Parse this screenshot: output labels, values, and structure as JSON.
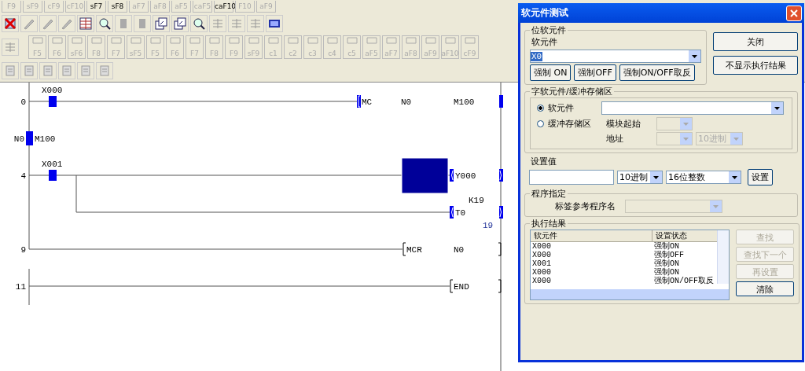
{
  "toolbar_keys_top": [
    {
      "key": "F9",
      "disabled": true
    },
    {
      "key": "sF9",
      "disabled": true
    },
    {
      "key": "cF9",
      "disabled": true
    },
    {
      "key": "cF10",
      "disabled": true
    },
    {
      "key": "sF7",
      "disabled": false
    },
    {
      "key": "sF8",
      "disabled": false
    },
    {
      "key": "aF7",
      "disabled": true
    },
    {
      "key": "aF8",
      "disabled": true
    },
    {
      "key": "aF5",
      "disabled": true
    },
    {
      "key": "caF5",
      "disabled": true
    },
    {
      "key": "caF10",
      "disabled": false
    },
    {
      "key": "F10",
      "disabled": true
    },
    {
      "key": "aF9",
      "disabled": true
    }
  ],
  "toolbar_keys": [
    {
      "key": "F5",
      "disabled": true
    },
    {
      "key": "F6",
      "disabled": true
    },
    {
      "key": "sF6",
      "disabled": true
    },
    {
      "key": "F8",
      "disabled": true
    },
    {
      "key": "F7",
      "disabled": true
    },
    {
      "key": "sF5",
      "disabled": true
    },
    {
      "key": "F5",
      "disabled": true
    },
    {
      "key": "F6",
      "disabled": true
    },
    {
      "key": "F7",
      "disabled": true
    },
    {
      "key": "F8",
      "disabled": true
    },
    {
      "key": "F9",
      "disabled": true
    },
    {
      "key": "sF9",
      "disabled": true
    },
    {
      "key": "c1",
      "disabled": true
    },
    {
      "key": "c2",
      "disabled": true
    },
    {
      "key": "c3",
      "disabled": true
    },
    {
      "key": "c4",
      "disabled": true
    },
    {
      "key": "c5",
      "disabled": true
    },
    {
      "key": "aF5",
      "disabled": true
    },
    {
      "key": "aF7",
      "disabled": true
    },
    {
      "key": "aF8",
      "disabled": true
    },
    {
      "key": "aF9",
      "disabled": true
    },
    {
      "key": "aF10",
      "disabled": true
    },
    {
      "key": "cF9",
      "disabled": true
    }
  ],
  "ladder": {
    "rungs": [
      {
        "kind": "mc",
        "step": "0",
        "contact": "X000",
        "instruction": "MC",
        "operands": [
          "N0",
          "M100"
        ],
        "selected": false
      },
      {
        "kind": "nest",
        "nest": "N0",
        "device": "M100",
        "selected": false
      },
      {
        "kind": "coils",
        "step": "4",
        "contact": "X001",
        "selected": true,
        "coils": [
          {
            "device": "Y000"
          },
          {
            "device": "T0",
            "setting": "K19",
            "current": "19"
          }
        ]
      },
      {
        "kind": "mcr",
        "step": "9",
        "instruction": "MCR",
        "operands": [
          "N0"
        ],
        "selected": false
      },
      {
        "kind": "end",
        "step": "11",
        "instruction": "END",
        "selected": false
      }
    ]
  },
  "dialog": {
    "title": "软元件测试",
    "bit_group": {
      "title": "位软元件",
      "label": "软元件",
      "value": "X0",
      "buttons": [
        "强制 ON",
        "强制OFF",
        "强制ON/OFF取反"
      ]
    },
    "side_buttons": [
      "关闭",
      "不显示执行结果"
    ],
    "word_group": {
      "title": "字软元件/缓冲存储区",
      "radios": [
        {
          "label": "软元件",
          "selected": true
        },
        {
          "label": "缓冲存储区",
          "selected": false
        }
      ],
      "module_label": "模块起始",
      "address_label": "地址",
      "radix": "10进制"
    },
    "set_value": {
      "title": "设置值",
      "radix": "10进制",
      "type": "16位整数",
      "button": "设置"
    },
    "program": {
      "title": "程序指定",
      "label": "标签参考程序名"
    },
    "results": {
      "title": "执行结果",
      "columns": [
        "软元件",
        "设置状态"
      ],
      "rows": [
        [
          "X000",
          "强制ON"
        ],
        [
          "X000",
          "强制OFF"
        ],
        [
          "X001",
          "强制ON"
        ],
        [
          "X000",
          "强制ON"
        ],
        [
          "X000",
          "强制ON/OFF取反"
        ]
      ],
      "buttons": [
        {
          "label": "查找",
          "disabled": true
        },
        {
          "label": "查找下一个",
          "disabled": true
        },
        {
          "label": "再设置",
          "disabled": true
        },
        {
          "label": "清除",
          "disabled": false
        }
      ]
    }
  }
}
